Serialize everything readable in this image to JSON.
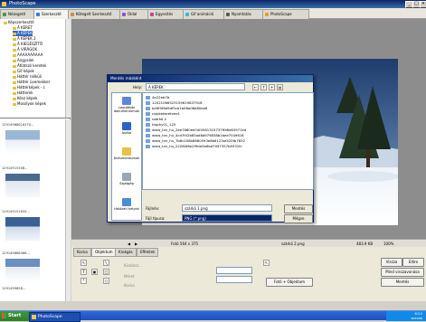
{
  "window": {
    "title": "PhotoScape"
  },
  "tabs": [
    {
      "label": "Nézegető",
      "color": "#4a9a3a"
    },
    {
      "label": "Szerkesztő",
      "color": "#3a7bd5"
    },
    {
      "label": "Kötegelt Szerkesztő",
      "color": "#d58a3a"
    },
    {
      "label": "Oldal",
      "color": "#9a4ad5"
    },
    {
      "label": "Egyesítés",
      "color": "#d53a8a"
    },
    {
      "label": "Gif animáció",
      "color": "#3ab5d5"
    },
    {
      "label": "Nyomtatás",
      "color": "#5a5a5a"
    },
    {
      "label": "PhotoScape",
      "color": "#e2a21b"
    }
  ],
  "tree": [
    "Képszerkesztő",
    "Á KERET",
    "Á KÉPEK",
    "Á KÉPEK 2",
    "Á KIEGÉSZÍTŐ",
    "Á VIRÁGOK",
    "AAAAAAAAAA",
    "Angyalok",
    "Átlátszó keretek",
    "Gif képek",
    "Háttér nélküli",
    "Háttér üvemekkel",
    "Háttérképek - c",
    "Hátterek",
    "Kész képek",
    "Mosolyok képek"
  ],
  "thumbnails": [
    {
      "label": "12914968616370..."
    },
    {
      "label": "12914915308..."
    },
    {
      "label": "129149151633..."
    },
    {
      "label": "129149868466..."
    },
    {
      "label": "1291499858..."
    }
  ],
  "dialog": {
    "title": "Mentés másként",
    "location_label": "Hely:",
    "location_value": "Á KÉPEK",
    "files": [
      "4e22eb7b",
      "12021066523159619837916",
      "bd9f0f8d9df5cb1b06a08d80ee8",
      "csipkekeretvee1",
      "szárkö 2",
      "trophy01_125",
      "www_tvn_hu_2ee7880ee04f4561315737ffa6e63971ed",
      "www_tvn_hu_4cd7f02b85ad8d979838b1bee7049616",
      "www_tvn_hu_7b8c206b8680593e8b6123af420fb7832",
      "www_tvn_hu_22280f8e2f9dd2b6bd7097357b9331fc"
    ],
    "places": [
      "Legutóbbi dokumentumok",
      "Asztal",
      "Dokumentumok",
      "Sajátgép",
      "Hálózati helyek"
    ],
    "filename_label": "Fájlnév:",
    "filename_value": "szárkö 1.png",
    "filetype_label": "Fájl típusa:",
    "filetype_value": "PNG (*.png)",
    "save_button": "Mentés",
    "cancel_button": "Mégse"
  },
  "status": {
    "size": "Fotó 564 x 375",
    "filename": "szárkö 2.png",
    "filesize": "483.9 KB",
    "zoom": "100%"
  },
  "props_tabs": [
    "Kocka",
    "Objektum",
    "Kivágás",
    "Effektek"
  ],
  "props": {
    "frame_text": "Fotó + Objektum",
    "right_buttons": [
      "Vissza",
      "Előre",
      "Mind visszavonása",
      "Mentés"
    ],
    "small_labels": [
      "Kiválasz...",
      "Méret",
      "Kocka"
    ]
  },
  "taskbar": {
    "start": "Start",
    "task": "PhotoScape",
    "time": "6:24",
    "day": "szerda",
    "date": "2010.12.08."
  }
}
